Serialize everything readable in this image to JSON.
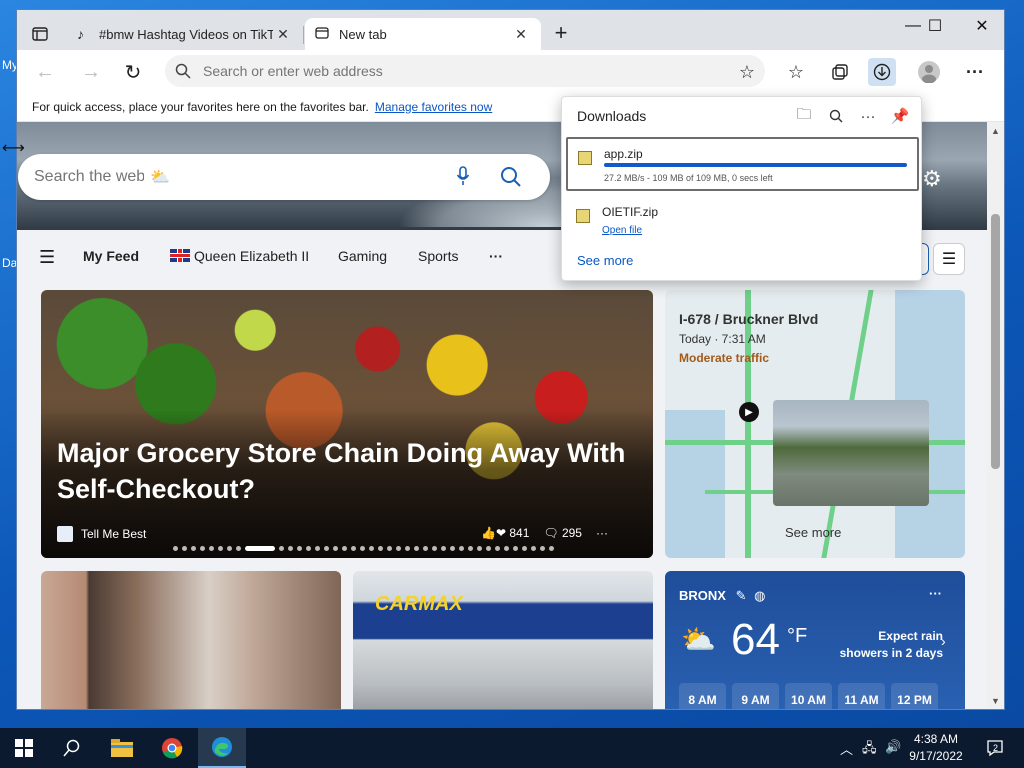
{
  "desktop": {
    "icon1_label": "My",
    "icon2_label": "Da"
  },
  "browser": {
    "tabs": [
      {
        "title": "#bmw Hashtag Videos on TikTok"
      },
      {
        "title": "New tab"
      }
    ],
    "window_controls": {
      "minimize": "—",
      "maximize": "☐",
      "close": "✕"
    },
    "toolbar": {
      "address_placeholder": "Search or enter web address"
    },
    "favorites_bar": {
      "message": "For quick access, place your favorites here on the favorites bar.",
      "link": "Manage favorites now"
    }
  },
  "newtab": {
    "search_placeholder": "Search the web",
    "feed_nav": {
      "items": [
        "My Feed",
        "Queen Elizabeth II",
        "Gaming",
        "Sports",
        "···"
      ]
    },
    "main_card": {
      "headline": "Major Grocery Store Chain Doing Away With Self-Checkout?",
      "source": "Tell Me Best",
      "reactions": "841",
      "comments": "295",
      "carousel": {
        "count": 40,
        "active_index": 8
      }
    },
    "traffic_card": {
      "title": "I-678 / Bruckner Blvd",
      "time": "Today · 7:31 AM",
      "status": "Moderate traffic",
      "see_more": "See more"
    },
    "weather_card": {
      "location": "BRONX",
      "temperature": "64",
      "unit": "°F",
      "condition": "Expect rain showers in 2 days",
      "hours": [
        "8 AM",
        "9 AM",
        "10 AM",
        "11 AM",
        "12 PM"
      ]
    },
    "carmax_logo": "CARMAX"
  },
  "downloads": {
    "title": "Downloads",
    "items": [
      {
        "name": "app.zip",
        "status": "27.2 MB/s - 109 MB of 109 MB, 0 secs left",
        "progress": 1.0
      },
      {
        "name": "OIETIF.zip",
        "action": "Open file"
      }
    ],
    "see_more": "See more"
  },
  "taskbar": {
    "time": "4:38 AM",
    "date": "9/17/2022",
    "notifications": "2"
  },
  "colors": {
    "accent": "#1359c9",
    "link": "#0b57c5",
    "traffic_status": "#a35a1a",
    "weather_bg": "#1f4e9a"
  }
}
